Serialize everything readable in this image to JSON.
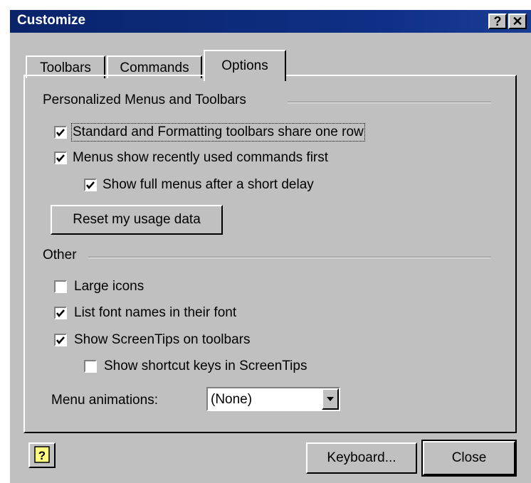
{
  "window": {
    "title": "Customize",
    "help_button": "?",
    "close_button": "✕"
  },
  "tabs": [
    {
      "label": "Toolbars"
    },
    {
      "label": "Commands"
    },
    {
      "label": "Options"
    }
  ],
  "personalized": {
    "heading": "Personalized Menus and Toolbars",
    "share_row": {
      "label": "Standard and Formatting toolbars share one row",
      "checked": true
    },
    "recent_first": {
      "label": "Menus show recently used commands first",
      "checked": true
    },
    "full_menus": {
      "label": "Show full menus after a short delay",
      "checked": true
    },
    "reset_button": "Reset my usage data"
  },
  "other": {
    "heading": "Other",
    "large_icons": {
      "label": "Large icons",
      "checked": false
    },
    "font_names": {
      "label": "List font names in their font",
      "checked": true
    },
    "screentips": {
      "label": "Show ScreenTips on toolbars",
      "checked": true
    },
    "shortcut_keys": {
      "label": "Show shortcut keys in ScreenTips",
      "checked": false
    },
    "menu_animations": {
      "label": "Menu animations:",
      "value": "(None)"
    }
  },
  "footer": {
    "keyboard_button": "Keyboard...",
    "close_button": "Close"
  }
}
